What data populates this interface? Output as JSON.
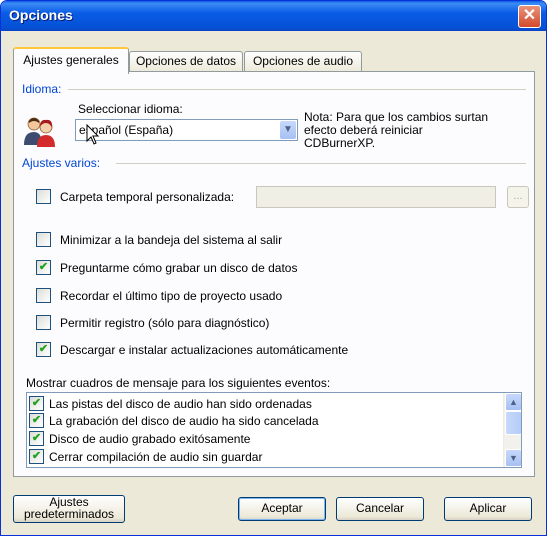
{
  "window": {
    "title": "Opciones",
    "close_symbol": "✕"
  },
  "tabs": [
    "Ajustes generales",
    "Opciones de datos",
    "Opciones de audio"
  ],
  "language_group": {
    "legend": "Idioma:",
    "select_label": "Seleccionar idioma:",
    "selected_language": "español (España)",
    "note": [
      "Nota: Para que los cambios surtan",
      "efecto deberá reiniciar",
      "CDBurnerXP."
    ]
  },
  "misc_group": {
    "legend": "Ajustes varios:",
    "temp_folder": {
      "label": "Carpeta temporal personalizada:",
      "checked": false,
      "value": "",
      "browse_label": "..."
    },
    "options": [
      {
        "label": "Minimizar a la bandeja del sistema al salir",
        "checked": false
      },
      {
        "label": "Preguntarme cómo grabar un disco de datos",
        "checked": true
      },
      {
        "label": "Recordar el último tipo de proyecto usado",
        "checked": false
      },
      {
        "label": "Permitir registro (sólo para diagnóstico)",
        "checked": false
      },
      {
        "label": "Descargar e instalar actualizaciones automáticamente",
        "checked": true
      }
    ]
  },
  "events": {
    "label": "Mostrar cuadros de mensaje para los siguientes eventos:",
    "items": [
      {
        "label": "Las pistas del disco de audio han sido ordenadas",
        "checked": true
      },
      {
        "label": "La grabación del disco de audio ha sido cancelada",
        "checked": true
      },
      {
        "label": "Disco de audio grabado exitósamente",
        "checked": true
      },
      {
        "label": "Cerrar compilación de audio sin guardar",
        "checked": true
      }
    ]
  },
  "buttons": {
    "defaults": [
      "Ajustes",
      "predeterminados"
    ],
    "ok": "Aceptar",
    "cancel": "Cancelar",
    "apply": "Aplicar"
  },
  "checkmark": "✔",
  "colors": {
    "title_blue": "#0a5ce6",
    "group_legend": "#0046d5",
    "check_green": "#21a121"
  }
}
